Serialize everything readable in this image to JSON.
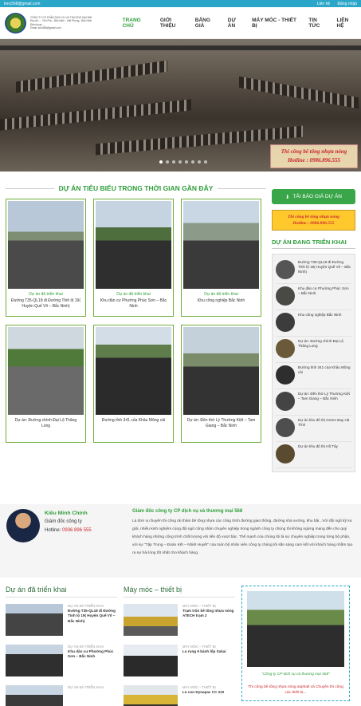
{
  "topbar": {
    "email": "kmc568@gmail.com",
    "links": [
      "Liên hệ",
      "Đăng nhập"
    ]
  },
  "header": {
    "company_lines": [
      "CÔNG TY CỔ PHẦN DỊCH VỤ VÀ THƯƠNG MẠI 568",
      "Địa chỉ: ... Yên Phụ - Bắc Ninh - Việt Phong - Bắc Ninh",
      "Điện thoại: ...",
      "Email: kmc568@gmail.com"
    ],
    "nav": [
      "TRANG CHỦ",
      "GIỚI THIỆU",
      "BẢNG GIÁ",
      "DỰ ÁN",
      "MÁY MÓC - THIẾT BỊ",
      "TIN TỨC",
      "LIÊN HỆ"
    ]
  },
  "hero": {
    "caption_line1": "Thi công bê tông nhựa nóng",
    "caption_line2": "Hotline : 0986.896.555"
  },
  "projects": {
    "title": "DỰ ÁN TIÊU BIỂU TRONG THỜI GIAN GẦN ĐÂY",
    "items": [
      {
        "cat": "Dự án đã triển khai",
        "title": "Đường T35-QL18 đi Đường Tỉnh lộ 19( Huyện Quế Võ – Bắc Ninh)"
      },
      {
        "cat": "Dự án đã triển khai",
        "title": "Khu dân cư Phường Phúc Sơn – Bắc Ninh"
      },
      {
        "cat": "Dự án đã triển khai",
        "title": "Khu công nghiệp Bắc Ninh"
      },
      {
        "cat": "",
        "title": "Dự án: Đường chính Đại Lộ Thăng Long"
      },
      {
        "cat": "",
        "title": "Đường tỉnh 341 của Khâu Mông cải"
      },
      {
        "cat": "",
        "title": "Dự án: Đền thờ Lý Thường Kiệt – Tam Giang – Bắc Ninh"
      }
    ]
  },
  "sidebar": {
    "quote_button": "TẢI BÁO GIÁ DỰ ÁN",
    "banner_line1": "Thi công bê tông nhựa nóng",
    "banner_line2": "Hotline : 0986.896.555",
    "heading": "DỰ ÁN ĐANG TRIỂN KHAI",
    "items": [
      "Đường T35-QL18 đi Đường Tỉnh lộ 19( Huyện Quế Võ – Bắc Ninh)",
      "Khu dân cư Phường Phúc Sơn – Bắc Ninh",
      "Khu công nghiệp Bắc Ninh",
      "Dự án: Đường chính Đại Lộ Thăng Long",
      "Đường tỉnh 341 của Khâu Mông cải",
      "Dự án: Đền thờ Lý Thường Kiệt – Tam Giang – Bắc Ninh",
      "Dự án khu đô thị Green Bay Hà Tĩnh",
      "Dự án khu đô thị Hồ Tây"
    ]
  },
  "bio": {
    "name": "Kiều Minh Chính",
    "role": "Giám đốc công ty",
    "hotline_label": "Hotline:",
    "hotline": "0936 896 555",
    "org": "Giám đốc công ty CP dịch vụ và thương mại 568",
    "text": "Là đơn vị chuyên thi công rải thảm bê tông nhựa các công trình đường giao thông, đường nhà xưởng, khu bãi...Với đội ngũ kỹ sư giỏi, nhiều kinh nghiệm cùng đội ngũ công nhân chuyên nghiệp trong ngành công ty chúng tôi không ngừng mang đến cho quý khách hàng những công trình chất lượng với tiến độ vượt bậc. Thế mạnh của chúng tôi là sự chuyên nghiệp trong từng bộ phận, với sự \"Tập Trung – Đoàn Kết – Nhiệt Huyết\" của toàn bộ nhân viên công ty chúng tôi sẵn sàng cam kết với khách hàng nhằm tạo ra sự hài lòng tốt nhất cho khách hàng."
  },
  "bottom": {
    "col1": {
      "title": "Dự án đã triển khai",
      "items": [
        {
          "cat": "DỰ ÁN ĐÃ TRIỂN KHAI",
          "title": "Đường T35-QL18 đi Đường Tỉnh lộ 19( Huyện Quế Võ – Bắc Ninh)"
        },
        {
          "cat": "DỰ ÁN ĐÃ TRIỂN KHAI",
          "title": "Khu dân cư Phường Phúc Sơn – Bắc Ninh"
        },
        {
          "cat": "DỰ ÁN ĐÃ TRIỂN KHAI",
          "title": ""
        }
      ]
    },
    "col2": {
      "title": "Máy móc – thiết bị",
      "items": [
        {
          "cat": "MÁY MÓC – THIẾT BỊ",
          "title": "Trạm trộn bê tông nhựa nóng ATECH trạm 2"
        },
        {
          "cat": "MÁY MÓC – THIẾT BỊ",
          "title": "Lu rung 9 bánh lốp Sakai"
        },
        {
          "cat": "MÁY MÓC – THIẾT BỊ",
          "title": "Lu con Dynapac CC 222"
        }
      ]
    },
    "promo": {
      "caption": "\"Công ty CP dịch vụ và thương mại 568\"",
      "sub": "Thi công bê tông nhựa nóng asphalt và Chuyên thi công các thiết bị..."
    }
  }
}
